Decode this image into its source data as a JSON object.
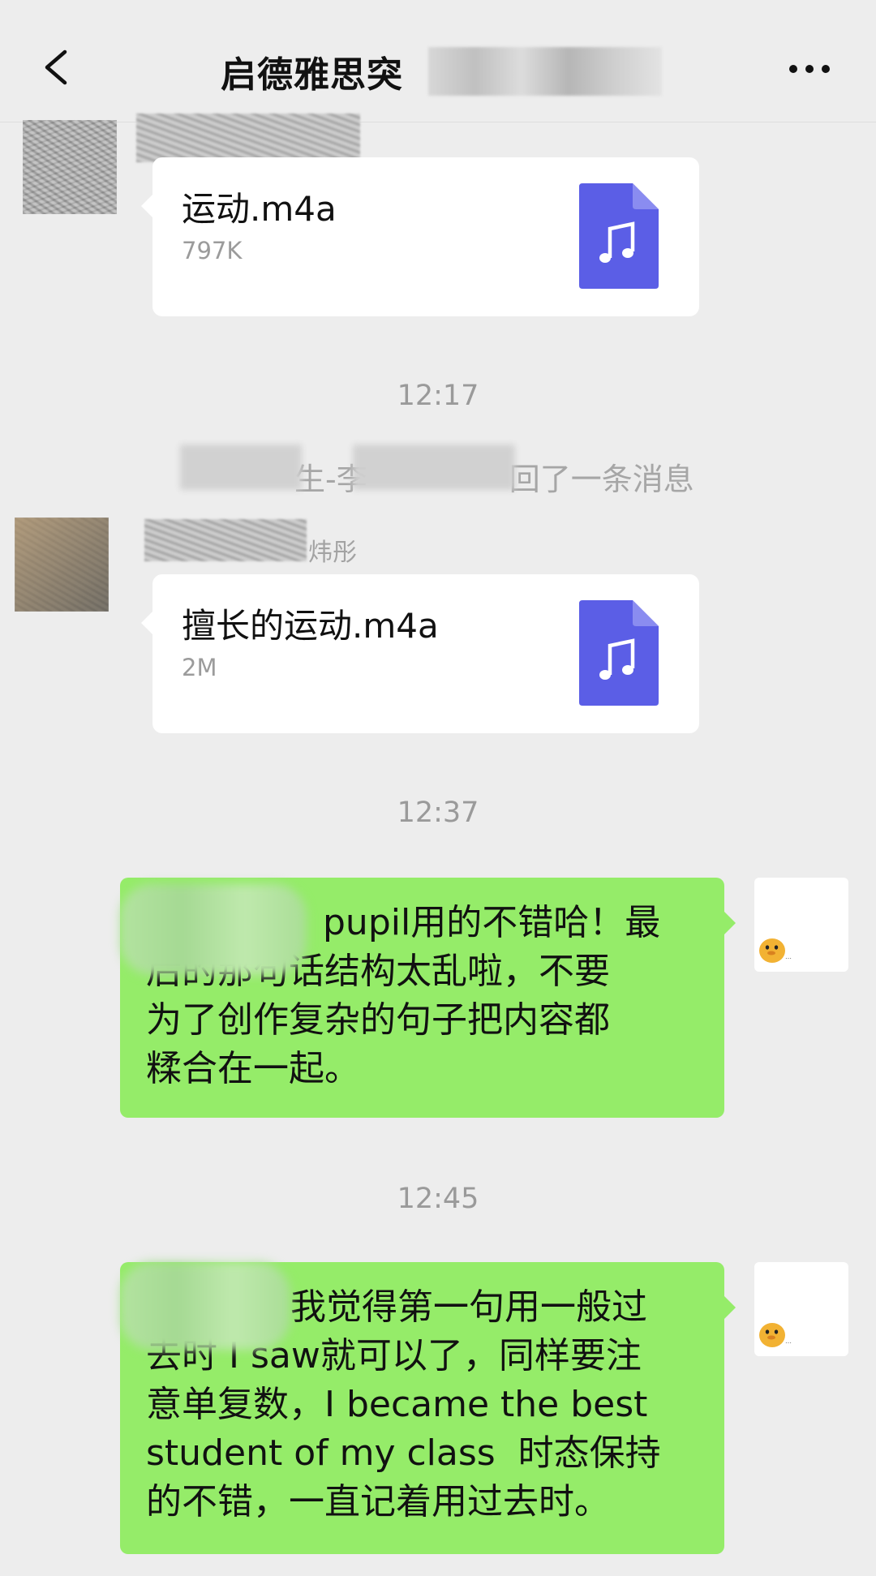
{
  "header": {
    "title": "启德雅思突"
  },
  "messages": [
    {
      "type": "file",
      "file_name": "运动.m4a",
      "file_size": "797K"
    },
    {
      "type": "time",
      "text": "12:17"
    },
    {
      "type": "system",
      "prefix": "生-李",
      "suffix": "回了一条消息"
    },
    {
      "type": "file",
      "sender_partial": "炜彤",
      "file_name": "擅长的运动.m4a",
      "file_size": "2M"
    },
    {
      "type": "time",
      "text": "12:37"
    },
    {
      "type": "text",
      "text": "pupil用的不错哈！最\n后的那句话结构太乱啦，不要\n为了创作复杂的句子把内容都\n糅合在一起。"
    },
    {
      "type": "time",
      "text": "12:45"
    },
    {
      "type": "text",
      "text": "我觉得第一句用一般过\n去时 I saw就可以了，同样要注\n意单复数，I became the best\nstudent of my class  时态保持\n的不错，一直记着用过去时。"
    }
  ],
  "colors": {
    "background": "#ededed",
    "bubble_self": "#95ec69",
    "bubble_other": "#ffffff",
    "file_icon": "#5b5ee6",
    "timestamp": "#9a9a9a"
  },
  "icons": {
    "back": "chevron-left-icon",
    "more": "more-dots-icon",
    "file": "music-file-icon"
  }
}
